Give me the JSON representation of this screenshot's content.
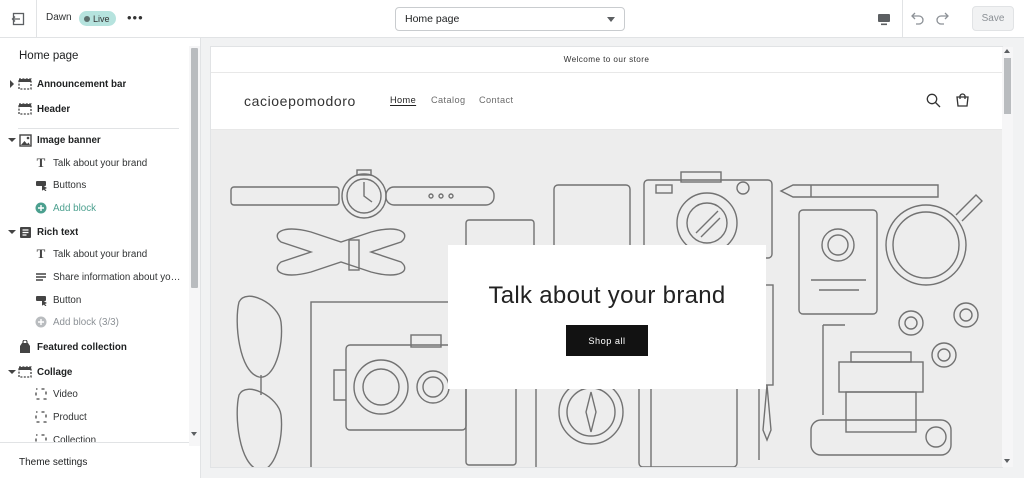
{
  "topbar": {
    "theme_name": "Dawn",
    "status_badge": "Live",
    "more_label": "•••",
    "page_select": "Home page",
    "save_label": "Save"
  },
  "sidebar": {
    "title": "Home page",
    "rows": [
      {
        "type": "section",
        "label": "Announcement bar",
        "icon": "announcement-bar-icon",
        "chevron": "right"
      },
      {
        "type": "section",
        "label": "Header",
        "icon": "header-icon",
        "chevron": "none"
      },
      {
        "type": "section",
        "label": "Image banner",
        "icon": "image-icon",
        "chevron": "down"
      },
      {
        "type": "block",
        "label": "Talk about your brand",
        "icon": "text-icon"
      },
      {
        "type": "block",
        "label": "Buttons",
        "icon": "button-icon"
      },
      {
        "type": "add",
        "label": "Add block",
        "icon": "plus-circle-icon"
      },
      {
        "type": "section",
        "label": "Rich text",
        "icon": "rich-text-icon",
        "chevron": "down"
      },
      {
        "type": "block",
        "label": "Talk about your brand",
        "icon": "text-icon"
      },
      {
        "type": "block",
        "label": "Share information about your...",
        "icon": "paragraph-icon"
      },
      {
        "type": "block",
        "label": "Button",
        "icon": "button-icon"
      },
      {
        "type": "disabled",
        "label": "Add block (3/3)",
        "icon": "plus-circle-icon"
      },
      {
        "type": "section",
        "label": "Featured collection",
        "icon": "collection-icon",
        "chevron": "none"
      },
      {
        "type": "section",
        "label": "Collage",
        "icon": "collage-icon",
        "chevron": "down"
      },
      {
        "type": "block",
        "label": "Video",
        "icon": "dashed-square-icon"
      },
      {
        "type": "block",
        "label": "Product",
        "icon": "dashed-square-icon"
      },
      {
        "type": "block",
        "label": "Collection",
        "icon": "dashed-square-icon"
      }
    ],
    "footer_label": "Theme settings"
  },
  "preview": {
    "announcement": "Welcome to our store",
    "logo": "cacioepomodoro",
    "nav": [
      "Home",
      "Catalog",
      "Contact"
    ],
    "hero_title": "Talk about your brand",
    "hero_button": "Shop all"
  },
  "colors": {
    "accent_teal": "#4ca08f",
    "live_badge": "#b6e3de",
    "hero_button_bg": "#121212",
    "banner_bg": "#ededed"
  }
}
